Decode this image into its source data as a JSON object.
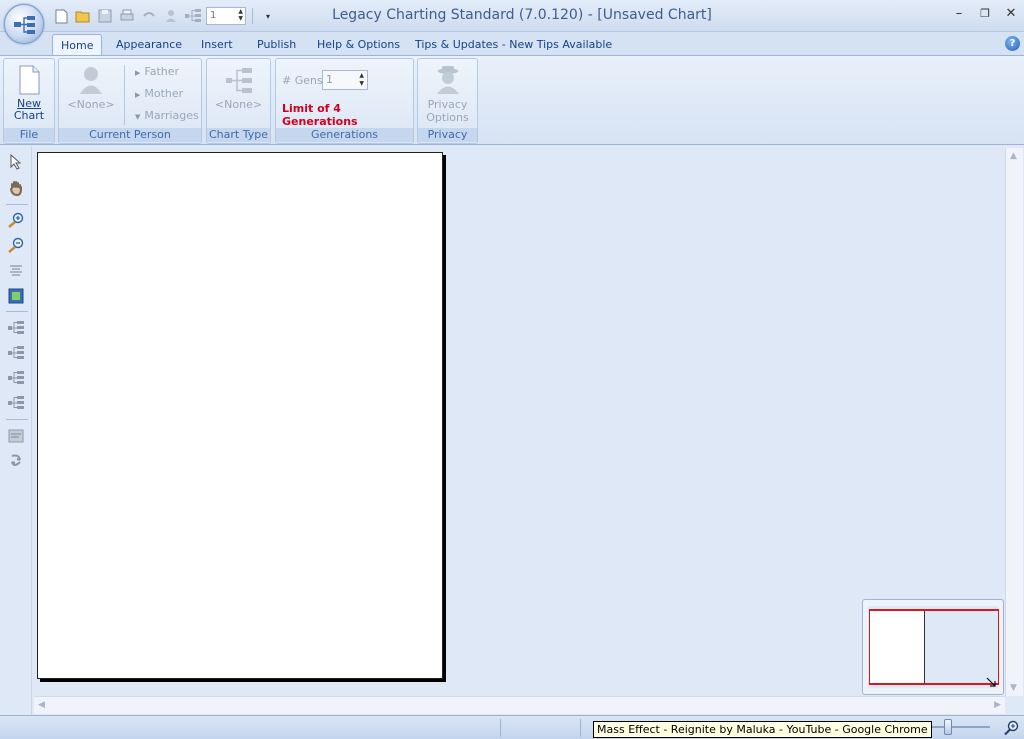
{
  "app": {
    "title": "Legacy Charting Standard (7.0.120) - [Unsaved Chart]"
  },
  "quick_access": {
    "spinner_value": "1"
  },
  "tabs": [
    {
      "label": "Home",
      "active": true
    },
    {
      "label": "Appearance"
    },
    {
      "label": "Insert"
    },
    {
      "label": "Publish"
    },
    {
      "label": "Help & Options"
    },
    {
      "label": "Tips & Updates - New Tips Available"
    }
  ],
  "ribbon": {
    "file": {
      "new_chart_label_line1": "New",
      "new_chart_label_line2": "Chart",
      "group_label": "File"
    },
    "current_person": {
      "person_value": "<None>",
      "father": "Father",
      "mother": "Mother",
      "marriages": "Marriages",
      "group_label": "Current Person"
    },
    "chart_type": {
      "value": "<None>",
      "group_label": "Chart Type"
    },
    "generations": {
      "gens_label": "# Gens",
      "gens_value": "1",
      "limit_text": "Limit of 4 Generations",
      "group_label": "Generations"
    },
    "privacy": {
      "label_line1": "Privacy",
      "label_line2": "Options",
      "group_label": "Privacy"
    }
  },
  "statusbar": {
    "tooltip": "Mass Effect - Reignite by Maluka - YouTube - Google Chrome"
  },
  "colors": {
    "accent": "#15428b",
    "limit_red": "#d1001f",
    "navigator_view": "#d31b1b"
  }
}
